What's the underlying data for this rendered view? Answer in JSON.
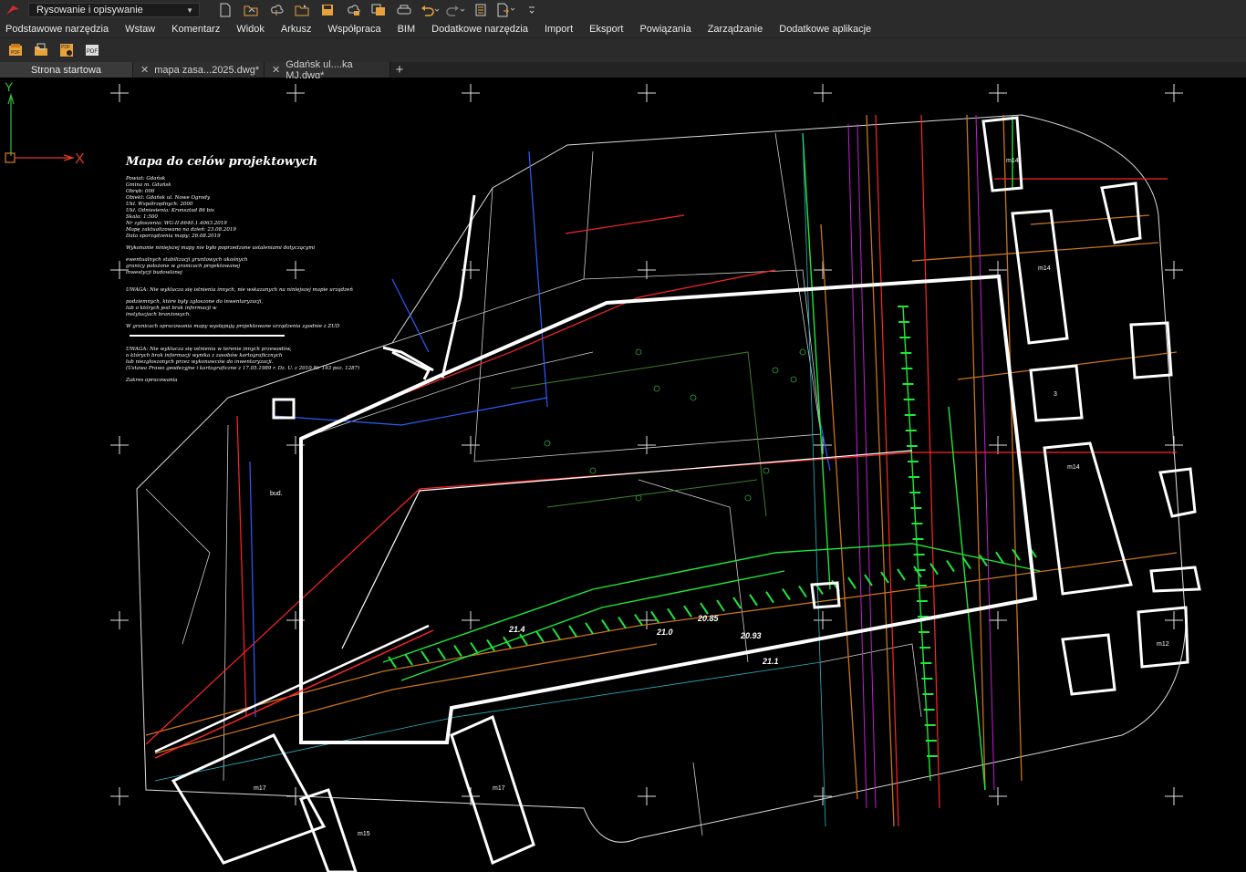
{
  "app": {
    "workspace": "Rysowanie i opisywanie",
    "workspace_icon": "chevron-down-icon",
    "accent_color": "#e03030"
  },
  "quick_access": [
    "new-file-icon",
    "open-icon",
    "cloud-open-icon",
    "open-folder-icon",
    "save-icon",
    "save-cloud-icon",
    "save-as-icon",
    "print-icon",
    "undo-icon",
    "redo-icon",
    "properties-icon",
    "publish-icon",
    "more-icon"
  ],
  "menu": [
    "Podstawowe narzędzia",
    "Wstaw",
    "Komentarz",
    "Widok",
    "Arkusz",
    "Współpraca",
    "BIM",
    "Dodatkowe narzędzia",
    "Import",
    "Eksport",
    "Powiązania",
    "Zarządzanie",
    "Dodatkowe aplikacje"
  ],
  "toolbar": {
    "icons": [
      "batch-pdf-icon",
      "export-folder-icon",
      "pdf-settings-icon",
      "pdf-export-icon"
    ],
    "badge_pdf": "PDF"
  },
  "tabs": {
    "start": "Strona startowa",
    "docs": [
      "mapa zasa...2025.dwg*",
      "Gdańsk ul....ka MJ.dwg*"
    ],
    "close_glyph": "✕",
    "add_glyph": "+"
  },
  "drawing": {
    "title": "Mapa do celów projektowych",
    "info_lines": [
      "Powiat: Gdańsk",
      "Gmina m. Gdańsk",
      "Obręb: 006",
      "Obiekt: Gdańsk ul. Nowe Ogrody",
      "Ukł. Współrzędnych: 2000",
      "Ukł. Odniesienia: Kronsztad 86 bis",
      "Skala:    1:500",
      "Nr zgłoszenia: WG-II.6640.1.4063.2019",
      "Mapę zaktualizowano na dzień: 23.08.2019",
      "Data sporządzenia mapy: 26.08.2019"
    ],
    "note_1": "Wykonanie niniejszej mapy nie było poprzedzone ustaleniami dotyczącymi",
    "note_2": [
      "ewentualnych stabilizacji gruntowych ukośnych",
      "granicy położone w granicach projektowanej",
      "inwestycji budowlanej"
    ],
    "warning_1": "UWAGA: Nie wyklucza się istnienia innych, nie wskazanych na niniejszej mapie urządzeń",
    "note_3": [
      "podziemnych, które  były zgłoszone do inwentaryzacji,",
      "lub o których jest brak informacji w",
      "instytucjach branżowych."
    ],
    "note_4": "W granicach opracowania mapy występują projektowane urządzenia zgodnie z ZUD",
    "warning_2": [
      "UWAGA: Nie wyklucza się istnienia w terenie innych przewodów,",
      "o których brak informacji wynika z zasobów kartograficznych",
      "lub niezgłoszonych przez wykonawców do inwentaryzacji.",
      "(Ustawa Prawo geodezyjne i kartograficzne z 17.05.1989 r. Dz. U. z 2010 Nr 193 poz. 1287)"
    ],
    "footer": "Zakres opracowania",
    "building_labels": [
      "m14",
      "m14",
      "m14",
      "m12",
      "m17",
      "m17",
      "m15",
      "bud.",
      "3"
    ],
    "elevations": [
      "21.4",
      "21.0",
      "20.85",
      "20.93",
      "21.1"
    ],
    "crosshair_icon": "crosshair-marker-icon",
    "colors": {
      "boundary": "#ffffff",
      "water": "#2c5cff",
      "gas": "#ff2a2a",
      "telecom": "#1ee83a",
      "sewer": "#d07a1a",
      "power": "#c020d0",
      "green_area": "#4a7a2a"
    }
  },
  "ucs": {
    "x_label": "X",
    "y_label": "Y",
    "icon": "ucs-axis-icon"
  }
}
